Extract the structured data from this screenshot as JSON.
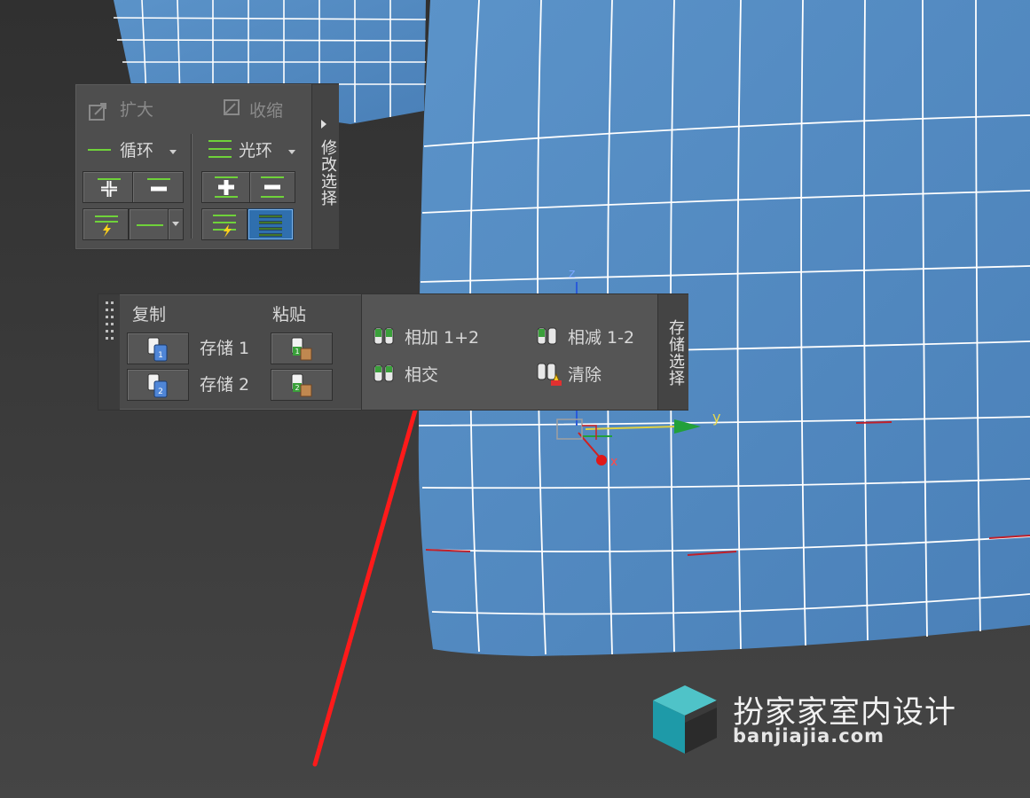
{
  "modify_selection": {
    "grow_label": "扩大",
    "shrink_label": "收缩",
    "loop_label": "循环",
    "ring_label": "光环",
    "tab_label": "修改选择"
  },
  "stored_selections": {
    "copy_label": "复制",
    "paste_label": "粘贴",
    "store1_label": "存储 1",
    "store2_label": "存储 2",
    "add_label": "相加 1+2",
    "subtract_label": "相减 1-2",
    "intersect_label": "相交",
    "clear_label": "清除",
    "tab_label": "存储选择"
  },
  "gizmo": {
    "z_label": "z",
    "y_label": "y",
    "x_label": "x"
  },
  "watermark": {
    "title": "扮家家室内设计",
    "url": "banjiajia.com"
  },
  "colors": {
    "viewport_bg": "#3a3a3a",
    "mesh_blue": "#4f86be",
    "panel_bg": "#4e4e4e",
    "accent_green": "#6fd23a",
    "annotation_red": "#ff1a1a"
  }
}
